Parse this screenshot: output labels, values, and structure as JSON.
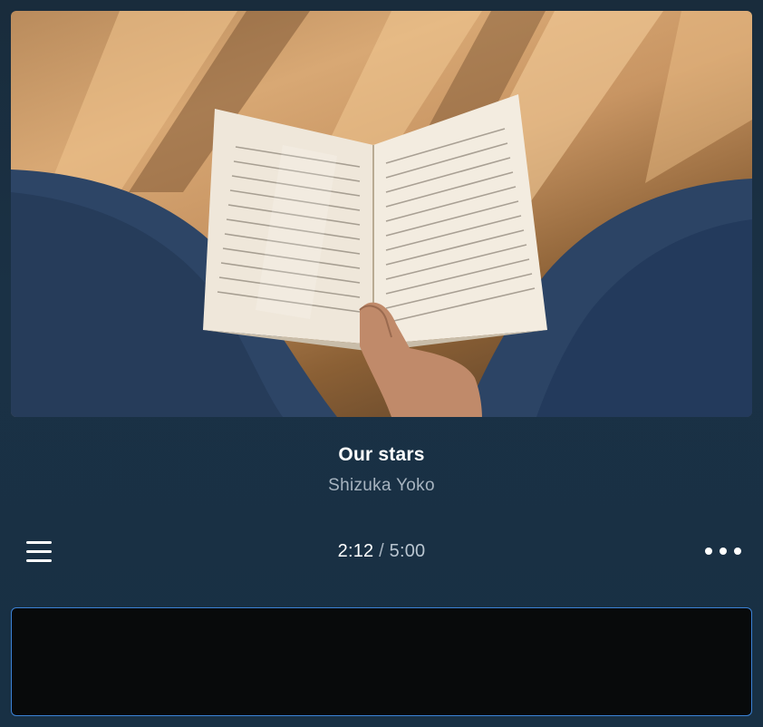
{
  "track": {
    "title": "Our stars",
    "artist": "Shizuka Yoko"
  },
  "playback": {
    "current_time": "2:12",
    "separator": " / ",
    "total_time": "5:00"
  },
  "icons": {
    "menu": "hamburger-menu-icon",
    "more": "more-options-icon"
  },
  "colors": {
    "background": "#1a3145",
    "accent_border": "#3b82d6",
    "artist_text": "#a7b4c0"
  }
}
